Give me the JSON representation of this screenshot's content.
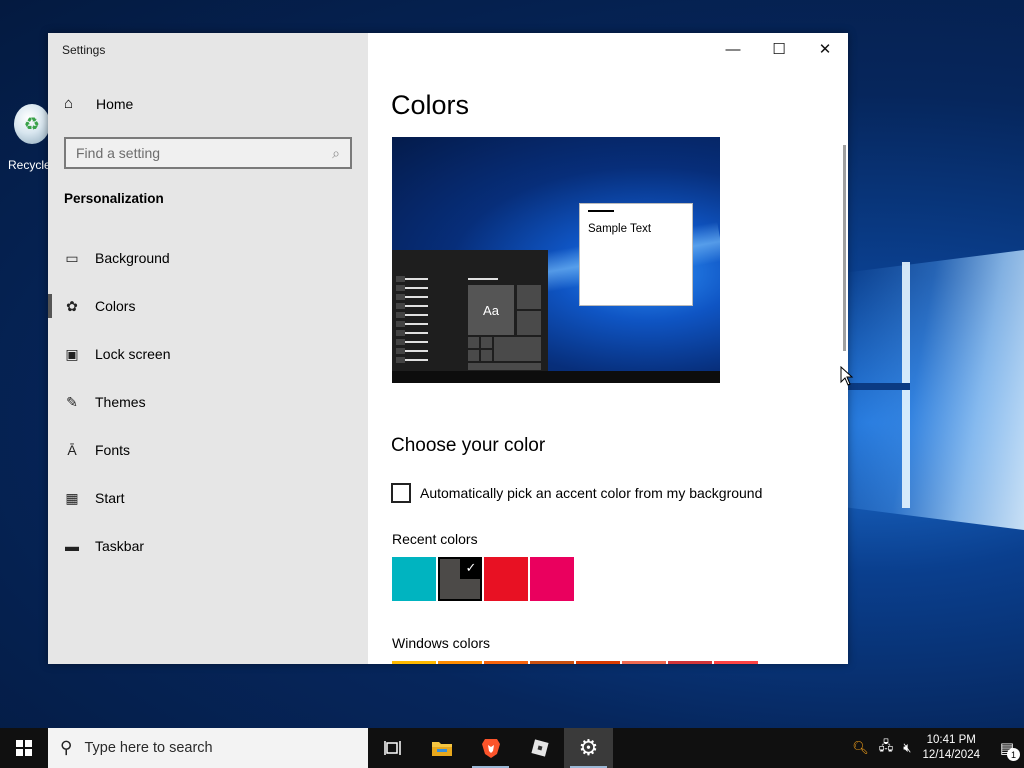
{
  "desktop": {
    "recycle_bin_label": "Recycle"
  },
  "window": {
    "title": "Settings",
    "caption": {
      "minimize_glyph": "—",
      "maximize_glyph": "☐",
      "close_glyph": "✕"
    }
  },
  "sidebar": {
    "home_label": "Home",
    "search_placeholder": "Find a setting",
    "section_title": "Personalization",
    "items": [
      {
        "label": "Background",
        "icon": "picture-icon",
        "active": false
      },
      {
        "label": "Colors",
        "icon": "palette-icon",
        "active": true
      },
      {
        "label": "Lock screen",
        "icon": "lock-screen-icon",
        "active": false
      },
      {
        "label": "Themes",
        "icon": "themes-icon",
        "active": false
      },
      {
        "label": "Fonts",
        "icon": "fonts-icon",
        "active": false
      },
      {
        "label": "Start",
        "icon": "start-icon",
        "active": false
      },
      {
        "label": "Taskbar",
        "icon": "taskbar-icon",
        "active": false
      }
    ]
  },
  "main": {
    "title": "Colors",
    "preview": {
      "tile_text": "Aa",
      "sample_text": "Sample Text"
    },
    "choose_heading": "Choose your color",
    "auto_accent_label": "Automatically pick an accent color from my background",
    "auto_accent_checked": false,
    "recent_colors_label": "Recent colors",
    "recent_colors": [
      "#00b4c0",
      "#4c4a48",
      "#e81123",
      "#ea005e"
    ],
    "recent_selected_index": 1,
    "windows_colors_label": "Windows colors",
    "windows_colors": [
      "#ffb900",
      "#ff8c00",
      "#f7630c",
      "#ca5010",
      "#da3b01",
      "#ef6950",
      "#d13438",
      "#ff4343"
    ]
  },
  "taskbar": {
    "search_placeholder": "Type here to search",
    "apps": [
      {
        "name": "task-view-icon",
        "running": false,
        "active": false
      },
      {
        "name": "file-explorer-icon",
        "running": false,
        "active": false
      },
      {
        "name": "brave-browser-icon",
        "running": true,
        "active": false
      },
      {
        "name": "roblox-icon",
        "running": false,
        "active": false
      },
      {
        "name": "settings-icon",
        "running": true,
        "active": true
      }
    ],
    "time": "10:41 PM",
    "date": "12/14/2024",
    "notification_count": "1"
  }
}
